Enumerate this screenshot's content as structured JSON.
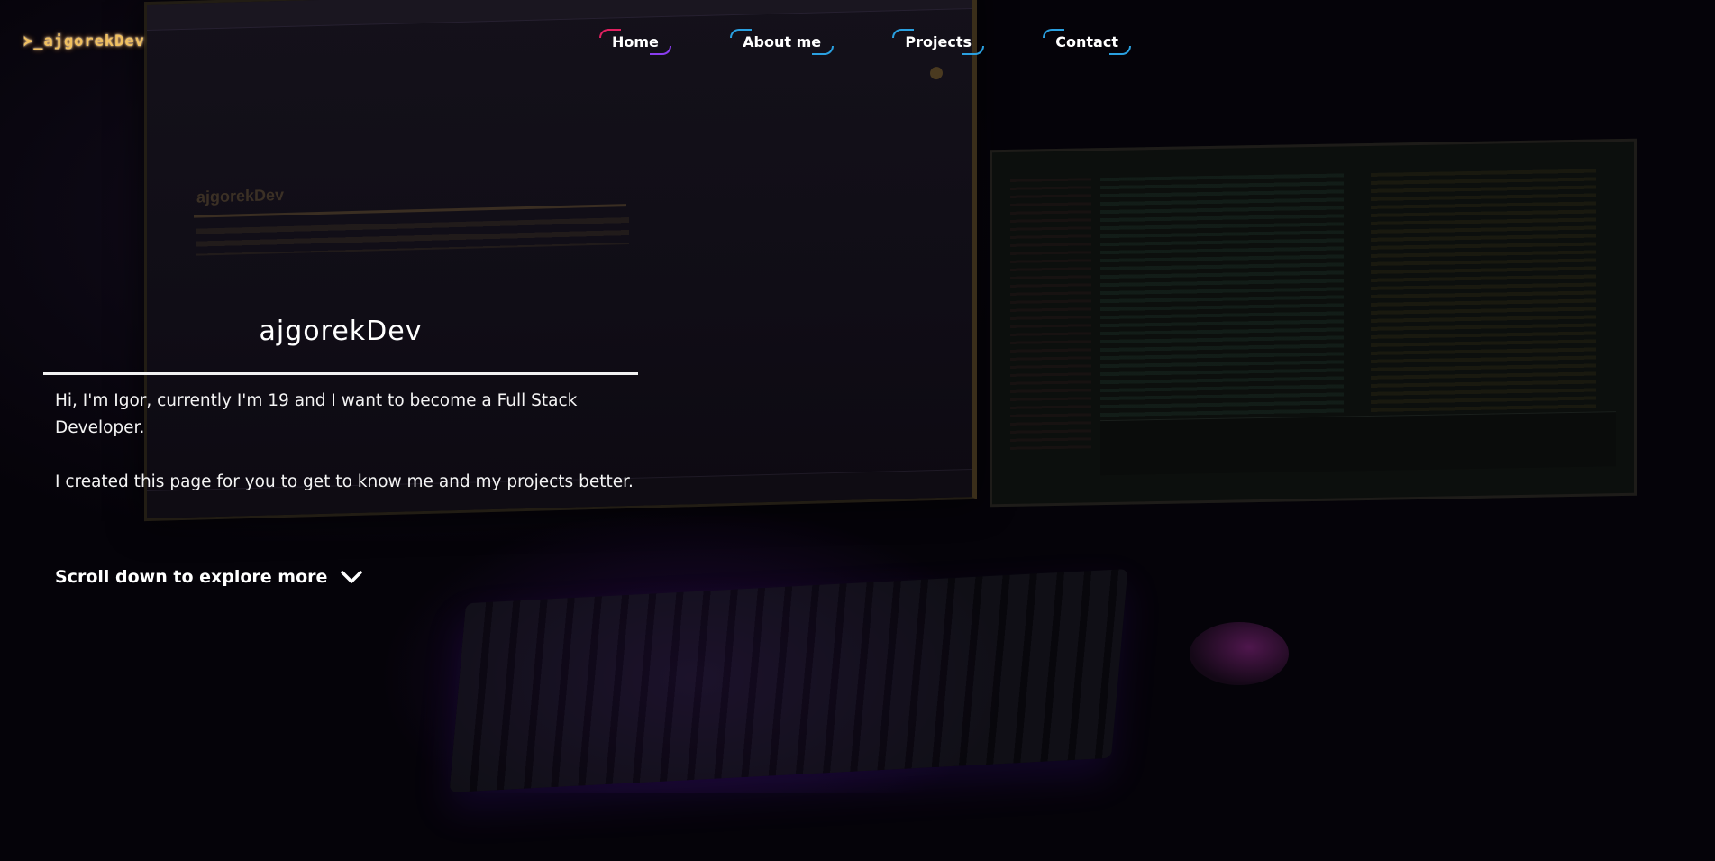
{
  "brand": {
    "logo_text": "≻_ajgorekDev"
  },
  "nav": {
    "items": [
      {
        "label": "Home"
      },
      {
        "label": "About me"
      },
      {
        "label": "Projects"
      },
      {
        "label": "Contact"
      }
    ]
  },
  "hero": {
    "title": "ajgorekDev",
    "intro": "Hi, I'm Igor, currently I'm 19 and I want to become a Full Stack Developer.",
    "note": "I created this page for you to get to know me and my projects better.",
    "scroll_label": "Scroll down to explore more",
    "scroll_icon": "chevron-down-icon"
  },
  "theme": {
    "background": "#050309",
    "logo_color": "#f0c060",
    "nav_accent_pink": "#e02060",
    "nav_accent_purple": "#8a3df0",
    "nav_accent_blue": "#2aa0e0"
  }
}
